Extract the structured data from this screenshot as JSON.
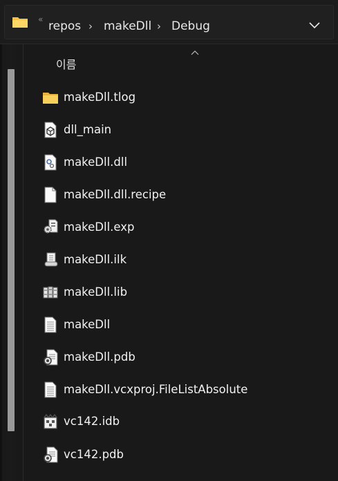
{
  "breadcrumb": {
    "overflow": "«",
    "items": [
      "repos",
      "makeDll",
      "Debug"
    ]
  },
  "header": {
    "column_name": "이름"
  },
  "files": [
    {
      "name": "makeDll.tlog",
      "icon": "folder-icon"
    },
    {
      "name": "dll_main",
      "icon": "cube-file-icon"
    },
    {
      "name": "makeDll.dll",
      "icon": "gear-file-icon"
    },
    {
      "name": "makeDll.dll.recipe",
      "icon": "blank-file-icon"
    },
    {
      "name": "makeDll.exp",
      "icon": "gears-file-icon"
    },
    {
      "name": "makeDll.ilk",
      "icon": "scroll-file-icon"
    },
    {
      "name": "makeDll.lib",
      "icon": "library-file-icon"
    },
    {
      "name": "makeDll",
      "icon": "text-file-icon"
    },
    {
      "name": "makeDll.pdb",
      "icon": "pdb-file-icon"
    },
    {
      "name": "makeDll.vcxproj.FileListAbsolute",
      "icon": "text-file-icon"
    },
    {
      "name": "vc142.idb",
      "icon": "idb-file-icon"
    },
    {
      "name": "vc142.pdb",
      "icon": "pdb-file-icon"
    }
  ],
  "colors": {
    "background": "#191919",
    "folder": "#f5c242",
    "text": "#f2f2f2"
  }
}
